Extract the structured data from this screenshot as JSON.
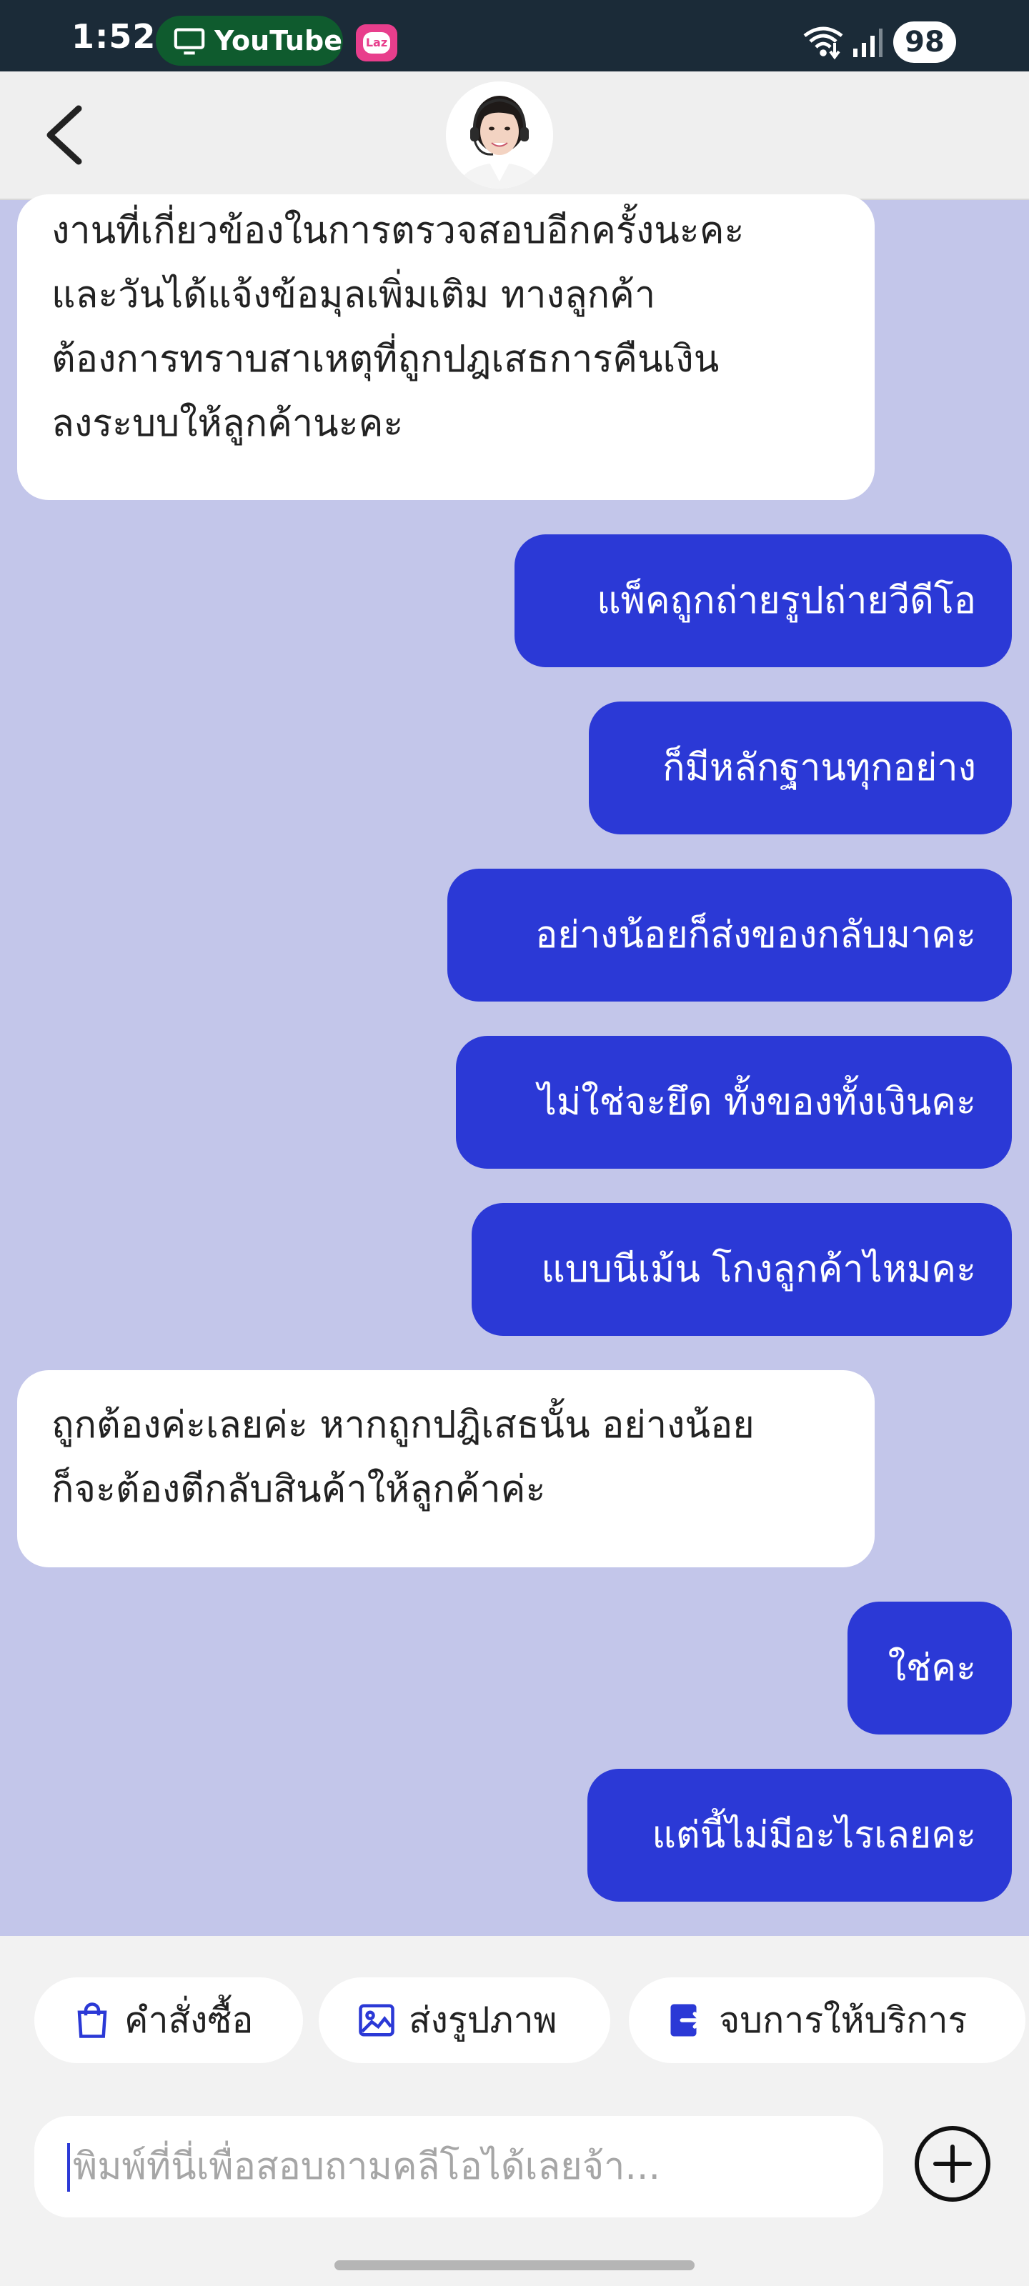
{
  "status_bar": {
    "time": "1:52",
    "app_label": "YouTube",
    "laz_badge": "Laz",
    "battery": "98",
    "icons": [
      "tv-icon",
      "laz-icon",
      "wifi-icon",
      "signal-icon"
    ]
  },
  "header": {
    "back_icon": "chevron-left-icon",
    "avatar": "agent-avatar"
  },
  "messages": [
    {
      "from": "agent",
      "lines": [
        "งานที่เกี่ยวข้องในการตรวจสอบอีกครั้งนะคะ",
        "และวันได้แจ้งข้อมุลเพิ่มเติม ทางลูกค้า",
        "ต้องการทราบสาเหตุที่ถูกปฎเสธการคืนเงิน",
        "ลงระบบให้ลูกค้านะคะ"
      ]
    },
    {
      "from": "user",
      "text": "แพ็คถูกถ่ายรูปถ่ายวีดีโอ"
    },
    {
      "from": "user",
      "text": "ก็มีหลักฐานทุกอย่าง"
    },
    {
      "from": "user",
      "text": "อย่างน้อยก็ส่งของกลับมาคะ"
    },
    {
      "from": "user",
      "text": "ไม่ใช่จะยึด ทั้งของทั้งเงินคะ"
    },
    {
      "from": "user",
      "text": "แบบนีเม้น โกงลูกค้าไหมคะ"
    },
    {
      "from": "agent",
      "lines": [
        "ถูกต้องค่ะเลยค่ะ หากถูกปฎิเสธนั้น อย่างน้อย",
        "ก็จะต้องตีกลับสินค้าให้ลูกค้าค่ะ"
      ]
    },
    {
      "from": "user",
      "text": "ใช่คะ"
    },
    {
      "from": "user",
      "text": "แต่นี้ไม่มีอะไรเลยคะ"
    }
  ],
  "quick_actions": [
    {
      "label": "คำสั่งซื้อ",
      "icon": "shopping-bag-icon"
    },
    {
      "label": "ส่งรูปภาพ",
      "icon": "image-icon"
    },
    {
      "label": "จบการให้บริการ",
      "icon": "exit-icon"
    }
  ],
  "composer": {
    "placeholder": "พิมพ์ที่นี่เพื่อสอบถามคลีโอได้เลยจ้า...",
    "value": "",
    "add_icon": "plus-circle-icon"
  },
  "colors": {
    "status_bar": "#1b2b38",
    "chat_background": "#c3c6ea",
    "user_bubble": "#2b39d6",
    "agent_bubble": "#ffffff",
    "youtube_pill": "#0f5b2e",
    "laz_badge": "#e83e8c"
  }
}
